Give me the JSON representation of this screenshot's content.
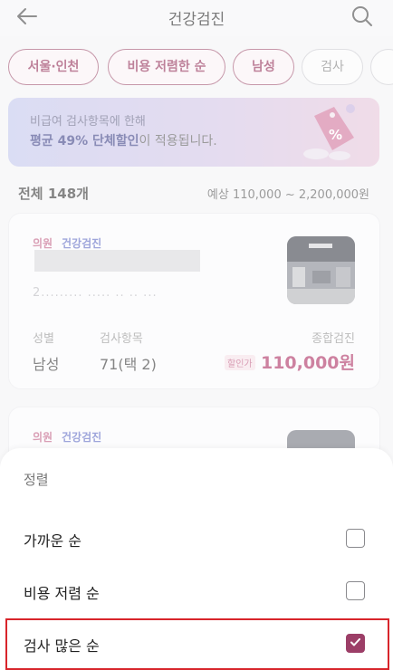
{
  "header": {
    "title": "건강검진",
    "back_icon": "back-arrow-icon",
    "search_icon": "search-icon"
  },
  "filters": [
    {
      "label": "서울·인천",
      "active": true
    },
    {
      "label": "비용 저렴한 순",
      "active": true
    },
    {
      "label": "남성",
      "active": true
    },
    {
      "label": "검사",
      "active": false
    }
  ],
  "banner": {
    "line1": "비급여 검사항목에 한해",
    "line2_bold": "평균 49% 단체할인",
    "line2_rest": "이 적용됩니다.",
    "icon": "discount-tag-icon"
  },
  "summary": {
    "total": "전체 148개",
    "range": "예상 110,000 ~ 2,200,000원"
  },
  "cards": [
    {
      "tag_type": "의원",
      "tag_category": "건강검진",
      "address": "2......... ..... .. .. ...",
      "gender_label": "성별",
      "gender_value": "남성",
      "items_label": "검사항목",
      "items_value": "71(택 2)",
      "type_label": "종합검진",
      "discount_badge": "할인가",
      "price": "110,000원"
    },
    {
      "tag_type": "의원",
      "tag_category": "건강검진"
    }
  ],
  "sheet": {
    "title": "정렬",
    "options": [
      {
        "label": "가까운 순",
        "checked": false
      },
      {
        "label": "비용 저렴 순",
        "checked": false
      },
      {
        "label": "검사 많은 순",
        "checked": true
      }
    ]
  },
  "colors": {
    "accent": "#9c3e67",
    "highlight_border": "#d8252b",
    "price": "#b33e6d"
  }
}
